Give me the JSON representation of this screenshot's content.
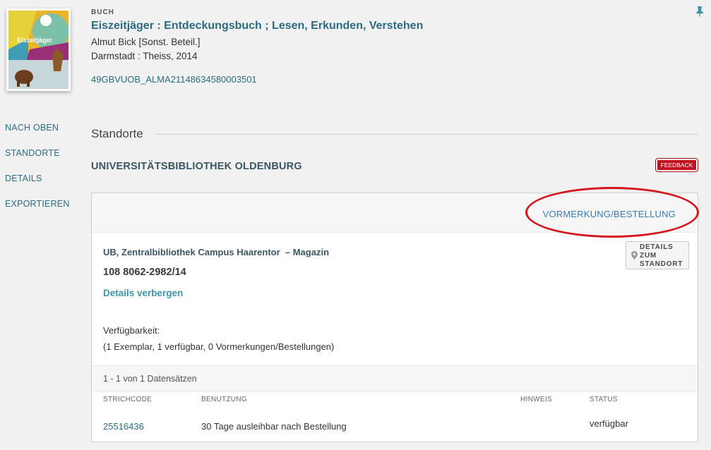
{
  "cover": {
    "alt": "Eiszeitjäger"
  },
  "record": {
    "type": "BUCH",
    "title": "Eiszeitjäger : Entdeckungsbuch ; Lesen, Erkunden, Verstehen",
    "author": "Almut Bick [Sonst. Beteil.]",
    "publisher": "Darmstadt : Theiss, 2014",
    "id": "49GBVUOB_ALMA21148634580003501"
  },
  "sidenav": {
    "items": [
      {
        "label": "NACH OBEN"
      },
      {
        "label": "STANDORTE"
      },
      {
        "label": "DETAILS"
      },
      {
        "label": "EXPORTIEREN"
      }
    ]
  },
  "section": {
    "title": "Standorte"
  },
  "library": {
    "name": "UNIVERSITÄTSBIBLIOTHEK OLDENBURG",
    "feedback_label": "FEEDBACK",
    "request_label": "VORMERKUNG/BESTELLUNG",
    "location_name": "UB, Zentralbibliothek Campus Haarentor",
    "location_sep": "– Magazin",
    "call_number": "108 8062-2982/14",
    "hide_details_label": "Details verbergen",
    "location_details_label": "DETAILS ZUM STANDORT",
    "location_details_lines": [
      "DETAILS",
      "ZUM",
      "STANDORT"
    ],
    "availability_label": "Verfügbarkeit:",
    "availability_detail": "(1 Exemplar, 1 verfügbar, 0 Vormerkungen/Bestellungen)",
    "records_info": "1 - 1 von 1 Datensätzen"
  },
  "items_table": {
    "headers": {
      "barcode": "STRICHCODE",
      "usage": "BENUTZUNG",
      "note": "HINWEIS",
      "status": "STATUS"
    },
    "rows": [
      {
        "barcode": "25516436",
        "usage": "30 Tage ausleihbar nach Bestellung",
        "note": "",
        "status": "verfügbar"
      }
    ]
  },
  "colors": {
    "accent": "#2c6b80",
    "feedback": "#c1121f",
    "highlight": "#d4161c"
  }
}
